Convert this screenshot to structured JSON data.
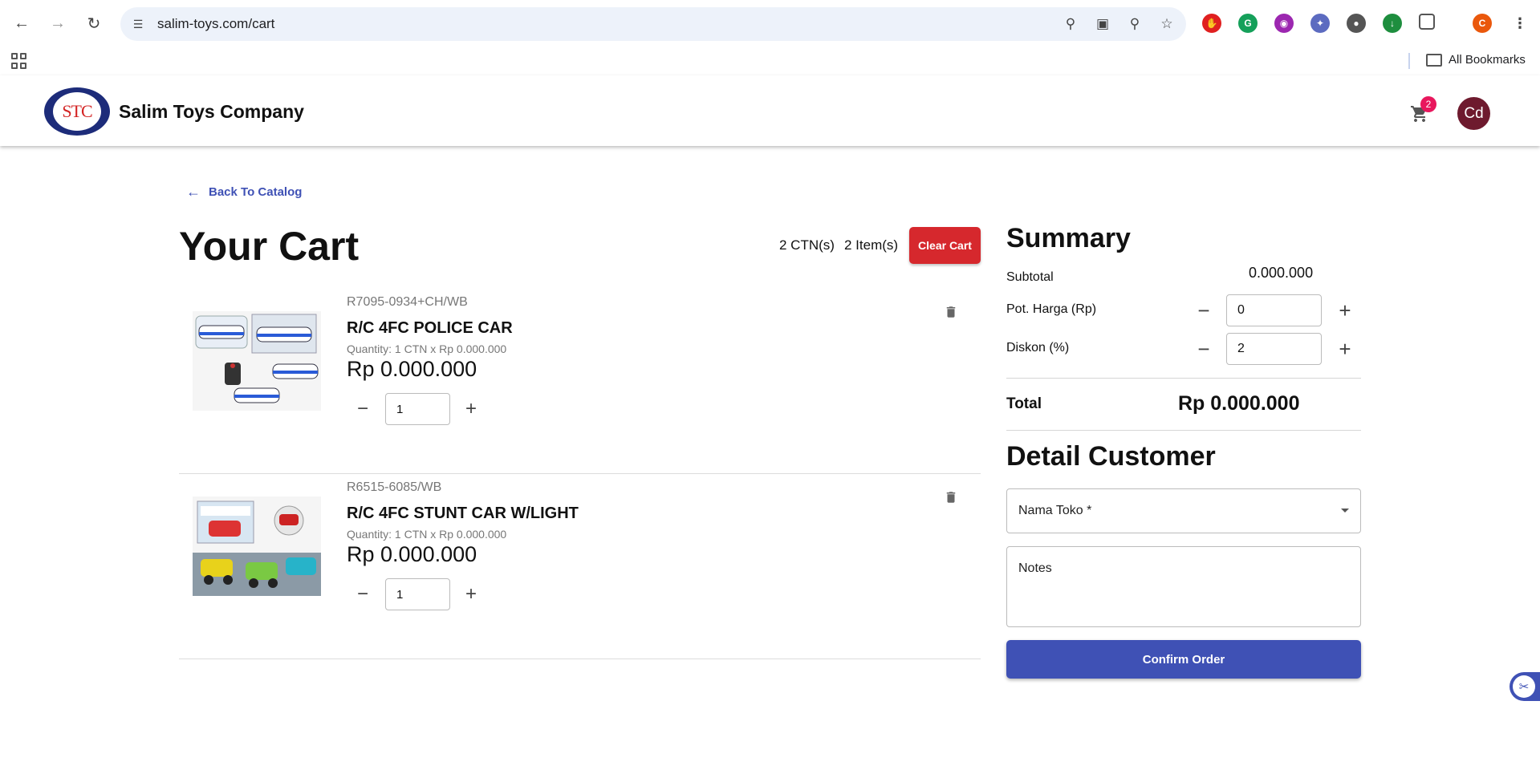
{
  "browser": {
    "url": "salim-toys.com/cart",
    "all_bookmarks": "All Bookmarks",
    "profile_initial": "C",
    "icons": [
      "back-arrow-icon",
      "forward-arrow-icon",
      "reload-icon",
      "site-settings-icon",
      "password-key-icon",
      "install-app-icon",
      "zoom-icon",
      "bookmark-star-icon"
    ]
  },
  "header": {
    "logo_text": "STC",
    "company": "Salim Toys Company",
    "cart_badge": "2",
    "avatar": "Cd"
  },
  "nav": {
    "back_label": "Back To Catalog"
  },
  "cart": {
    "title": "Your Cart",
    "ctn_count": "2 CTN(s)",
    "item_count": "2 Item(s)",
    "clear_label": "Clear Cart",
    "items": [
      {
        "code": "R7095-0934+CH/WB",
        "name": "R/C 4FC POLICE CAR",
        "qty_line": "Quantity: 1 CTN x Rp 0.000.000",
        "price": "Rp 0.000.000",
        "qty": "1"
      },
      {
        "code": "R6515-6085/WB",
        "name": "R/C 4FC STUNT CAR W/LIGHT",
        "qty_line": "Quantity: 1 CTN x Rp 0.000.000",
        "price": "Rp 0.000.000",
        "qty": "1"
      }
    ]
  },
  "summary": {
    "title": "Summary",
    "subtotal_label": "Subtotal",
    "subtotal_value": "0.000.000",
    "pot_label": "Pot. Harga (Rp)",
    "pot_value": "0",
    "diskon_label": "Diskon (%)",
    "diskon_value": "2",
    "total_label": "Total",
    "total_value": "Rp 0.000.000"
  },
  "customer": {
    "title": "Detail Customer",
    "nama_toko_label": "Nama Toko *",
    "notes_label": "Notes",
    "confirm_label": "Confirm Order"
  },
  "colors": {
    "primary": "#3f51b5",
    "danger": "#d6282d",
    "badge": "#e8175d",
    "avatar": "#6e1a2e"
  }
}
